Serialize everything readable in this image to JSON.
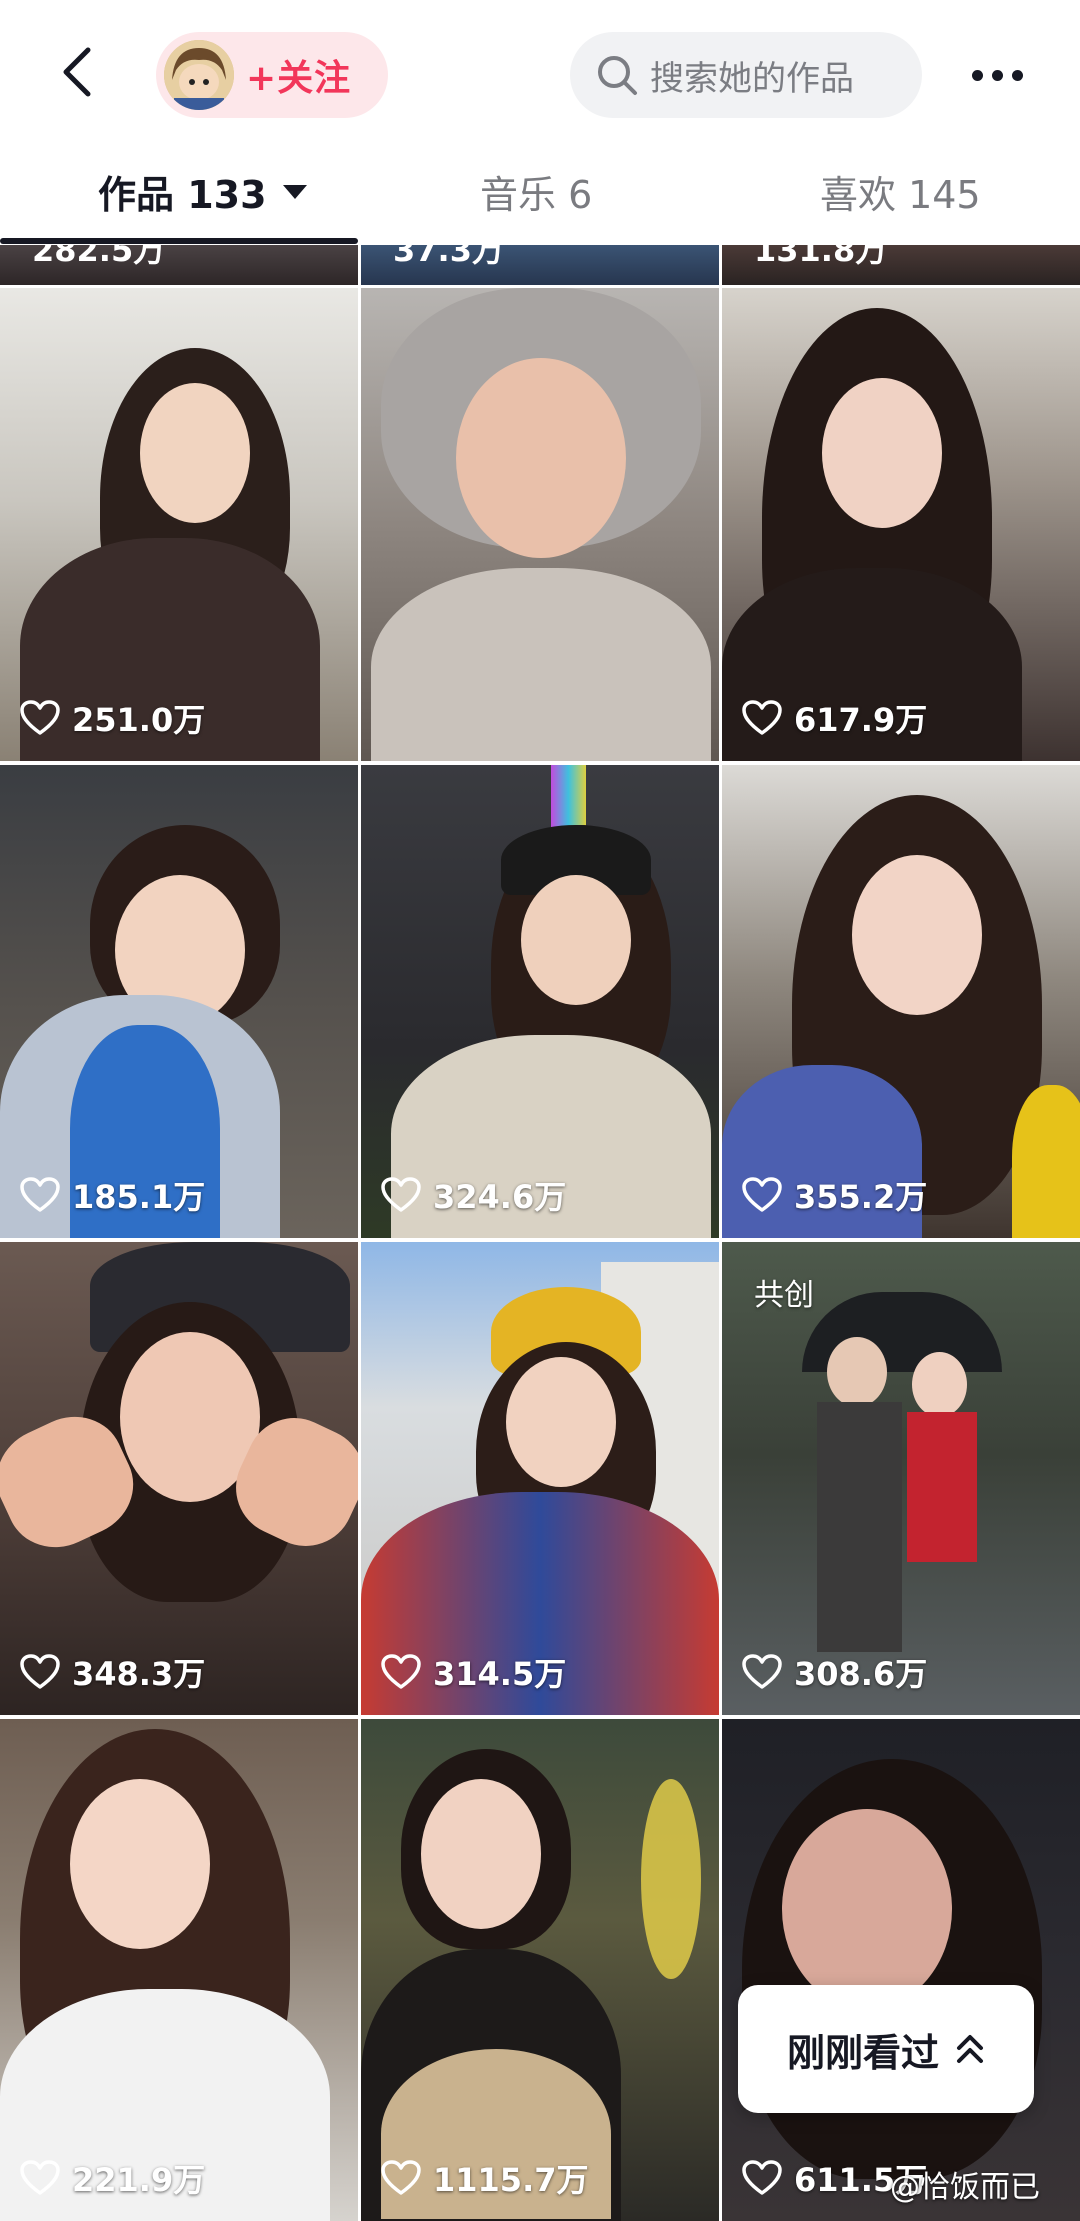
{
  "header": {
    "follow_label": "+关注",
    "search_placeholder": "搜索她的作品"
  },
  "tabs": [
    {
      "label": "作品 133",
      "active": true
    },
    {
      "label": "音乐 6",
      "active": false
    },
    {
      "label": "喜欢 145",
      "active": false
    }
  ],
  "partial_row": [
    "282.5万",
    "37.3万",
    "131.8万"
  ],
  "videos": [
    {
      "likes": "251.0万"
    },
    {
      "likes": "617.9万"
    },
    {
      "likes": "185.1万"
    },
    {
      "likes": "324.6万"
    },
    {
      "likes": "355.2万"
    },
    {
      "likes": "348.3万"
    },
    {
      "likes": "314.5万"
    },
    {
      "likes": "308.6万",
      "badge": "共创"
    },
    {
      "likes": "221.9万"
    },
    {
      "likes": "1115.7万"
    },
    {
      "likes": "611.5万"
    }
  ],
  "float_button": {
    "label": "刚刚看过"
  },
  "watermark": "@恰饭而已",
  "colors": {
    "accent": "#f2365a",
    "follow_bg": "#fde7ea",
    "search_bg": "#f1f2f4"
  }
}
